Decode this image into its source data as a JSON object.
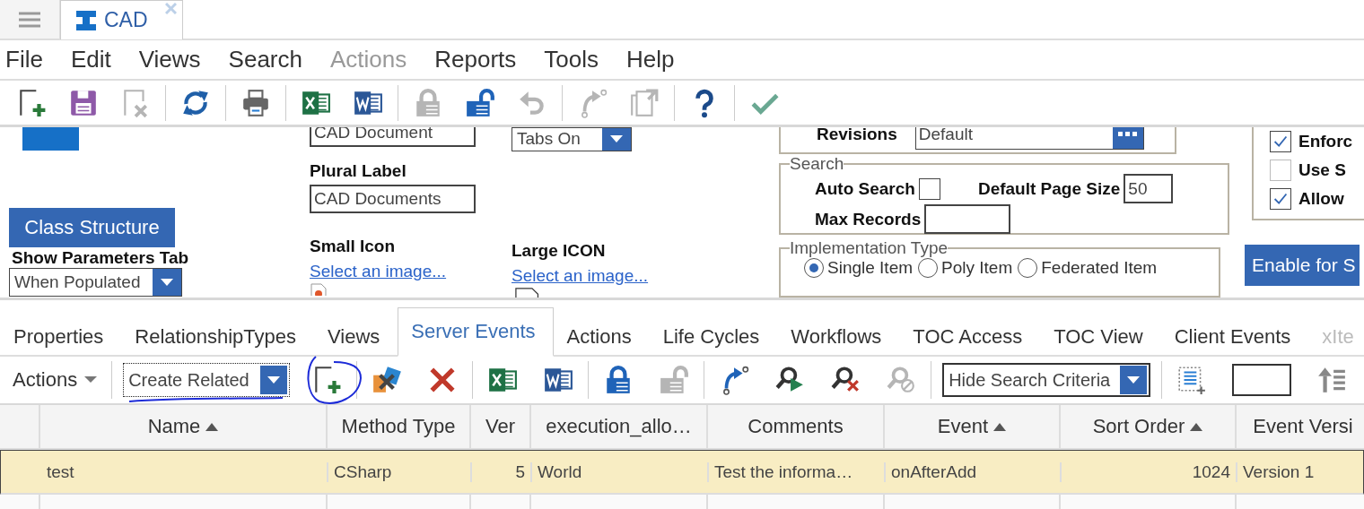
{
  "app_tabs": [
    {
      "label": "CAD",
      "selected": true
    }
  ],
  "menu": [
    {
      "label": "File",
      "disabled": false
    },
    {
      "label": "Edit",
      "disabled": false
    },
    {
      "label": "Views",
      "disabled": false
    },
    {
      "label": "Search",
      "disabled": false
    },
    {
      "label": "Actions",
      "disabled": true
    },
    {
      "label": "Reports",
      "disabled": false
    },
    {
      "label": "Tools",
      "disabled": false
    },
    {
      "label": "Help",
      "disabled": false
    }
  ],
  "toolbar": [
    {
      "kind": "new",
      "disabled": false
    },
    {
      "kind": "save",
      "disabled": false
    },
    {
      "kind": "discard",
      "disabled": true
    },
    {
      "kind": "separator"
    },
    {
      "kind": "refresh",
      "disabled": false
    },
    {
      "kind": "separator"
    },
    {
      "kind": "print",
      "disabled": false
    },
    {
      "kind": "separator"
    },
    {
      "kind": "sheet",
      "disabled": false
    },
    {
      "kind": "doc",
      "disabled": false
    },
    {
      "kind": "separator"
    },
    {
      "kind": "lock",
      "disabled": true
    },
    {
      "kind": "unlock",
      "disabled": false
    },
    {
      "kind": "undo",
      "disabled": true
    },
    {
      "kind": "separator"
    },
    {
      "kind": "promote",
      "disabled": true
    },
    {
      "kind": "copy",
      "disabled": true
    },
    {
      "kind": "separator"
    },
    {
      "kind": "help",
      "disabled": false
    },
    {
      "kind": "separator"
    },
    {
      "kind": "done",
      "disabled": false
    }
  ],
  "form": {
    "class_structure_button": "Class Structure",
    "show_parameters_tab": {
      "label": "Show Parameters Tab",
      "value": "When Populated"
    },
    "singular_label": {
      "value": "CAD Document"
    },
    "plural_label": {
      "label": "Plural Label",
      "value": "CAD Documents"
    },
    "small_icon": {
      "label": "Small Icon",
      "link": "Select an image..."
    },
    "tabs_select": {
      "value": "Tabs On"
    },
    "large_icon": {
      "label": "Large ICON",
      "link": "Select an image..."
    },
    "revisions": {
      "label": "Revisions",
      "value": "Default"
    },
    "search_group": {
      "legend": "Search",
      "auto_search": {
        "label": "Auto Search",
        "checked": false
      },
      "default_page_size": {
        "label": "Default Page Size",
        "value": "50"
      },
      "max_records": {
        "label": "Max Records"
      }
    },
    "implementation_type": {
      "legend": "Implementation Type",
      "options": [
        {
          "label": "Single Item",
          "selected": true
        },
        {
          "label": "Poly Item",
          "selected": false
        },
        {
          "label": "Federated Item",
          "selected": false
        }
      ]
    },
    "options_group": {
      "checkboxes": [
        {
          "label": "Enforc",
          "checked": true
        },
        {
          "label": "Use S",
          "checked": false
        },
        {
          "label": "Allow",
          "checked": true
        }
      ]
    },
    "enable_button": "Enable for S"
  },
  "relationship_tabs": [
    {
      "label": "Properties",
      "selected": false,
      "disabled": false
    },
    {
      "label": "RelationshipTypes",
      "selected": false,
      "disabled": false
    },
    {
      "label": "Views",
      "selected": false,
      "disabled": false
    },
    {
      "label": "Server Events",
      "selected": true,
      "disabled": false
    },
    {
      "label": "Actions",
      "selected": false,
      "disabled": false
    },
    {
      "label": "Life Cycles",
      "selected": false,
      "disabled": false
    },
    {
      "label": "Workflows",
      "selected": false,
      "disabled": false
    },
    {
      "label": "TOC Access",
      "selected": false,
      "disabled": false
    },
    {
      "label": "TOC View",
      "selected": false,
      "disabled": false
    },
    {
      "label": "Client Events",
      "selected": false,
      "disabled": false
    },
    {
      "label": "xIte",
      "selected": false,
      "disabled": true
    }
  ],
  "relationship_toolbar": [
    {
      "kind": "menu",
      "label": "Actions"
    },
    {
      "kind": "separator"
    },
    {
      "kind": "select",
      "value": "Create Related",
      "focused": true
    },
    {
      "kind": "new",
      "disabled": false
    },
    {
      "kind": "separator"
    },
    {
      "kind": "tiles",
      "disabled": false
    },
    {
      "kind": "delete",
      "disabled": false
    },
    {
      "kind": "separator"
    },
    {
      "kind": "sheet",
      "disabled": false
    },
    {
      "kind": "doc",
      "disabled": false
    },
    {
      "kind": "separator"
    },
    {
      "kind": "lock",
      "disabled": false
    },
    {
      "kind": "unlock",
      "disabled": true
    },
    {
      "kind": "separator"
    },
    {
      "kind": "promote",
      "disabled": false
    },
    {
      "kind": "search_run",
      "disabled": false
    },
    {
      "kind": "search_clear",
      "disabled": false
    },
    {
      "kind": "search_block",
      "disabled": true
    },
    {
      "kind": "separator"
    },
    {
      "kind": "select",
      "value": "Hide Search Criteria",
      "focused": false
    },
    {
      "kind": "separator"
    },
    {
      "kind": "list_add",
      "disabled": false
    },
    {
      "kind": "input"
    },
    {
      "kind": "sort_up",
      "disabled": false
    }
  ],
  "table": {
    "columns": [
      {
        "label": "Name",
        "sorted": true,
        "kind": "text"
      },
      {
        "label": "Method Type",
        "sorted": false,
        "kind": "text"
      },
      {
        "label": "Ver",
        "sorted": false,
        "kind": "number"
      },
      {
        "label": "execution_allo…",
        "sorted": false,
        "kind": "text"
      },
      {
        "label": "Comments",
        "sorted": false,
        "kind": "text"
      },
      {
        "label": "Event",
        "sorted": true,
        "kind": "text"
      },
      {
        "label": "Sort Order",
        "sorted": true,
        "kind": "number"
      },
      {
        "label": "Event Versi",
        "sorted": false,
        "kind": "text"
      }
    ],
    "rows": [
      {
        "selected": true,
        "cells": [
          "test",
          "CSharp",
          "5",
          "World",
          "Test the informa…",
          "onAfterAdd",
          "1024",
          "Version 1"
        ]
      }
    ]
  }
}
